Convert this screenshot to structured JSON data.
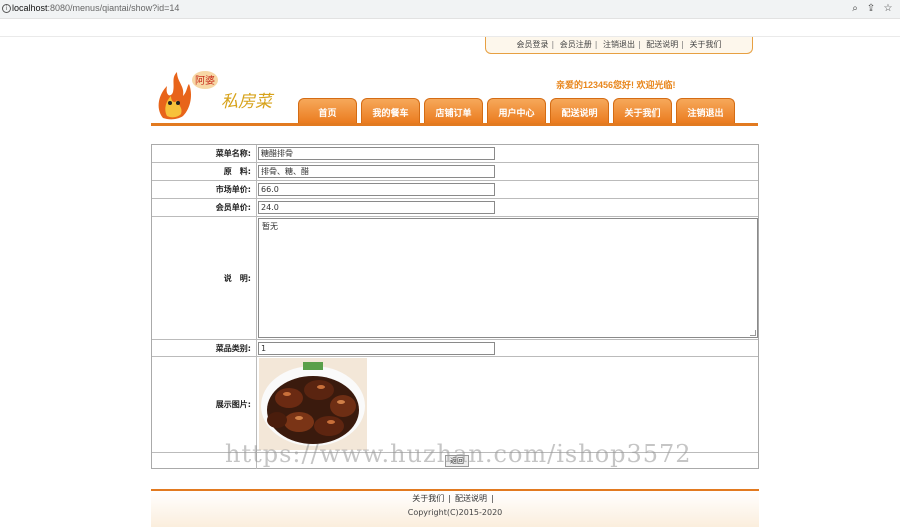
{
  "browser": {
    "url_host": "localhost",
    "url_path": ":8080/menus/qiantai/show?id=14"
  },
  "toplinks": [
    "会员登录",
    "会员注册",
    "注销退出",
    "配送说明",
    "关于我们"
  ],
  "logo": {
    "badge": "阿婆",
    "text": "私房菜"
  },
  "welcome": "亲爱的123456您好! 欢迎光临!",
  "nav": [
    "首页",
    "我的餐车",
    "店铺订单",
    "用户中心",
    "配送说明",
    "关于我们",
    "注销退出"
  ],
  "form": {
    "name_label": "菜单名称:",
    "name_value": "糖醋排骨",
    "material_label": "原　料:",
    "material_value": "排骨、糖、醋",
    "market_price_label": "市场单价:",
    "market_price_value": "66.0",
    "member_price_label": "会员单价:",
    "member_price_value": "24.0",
    "desc_label": "说　明:",
    "desc_value": "暂无",
    "category_label": "菜品类别:",
    "category_value": "1",
    "image_label": "展示图片:",
    "back_label": "返回"
  },
  "watermark": "https://www.huzhan.com/ishop3572",
  "footer": {
    "links": [
      "关于我们",
      "配送说明"
    ],
    "copyright": "Copyright(C)2015-2020"
  }
}
